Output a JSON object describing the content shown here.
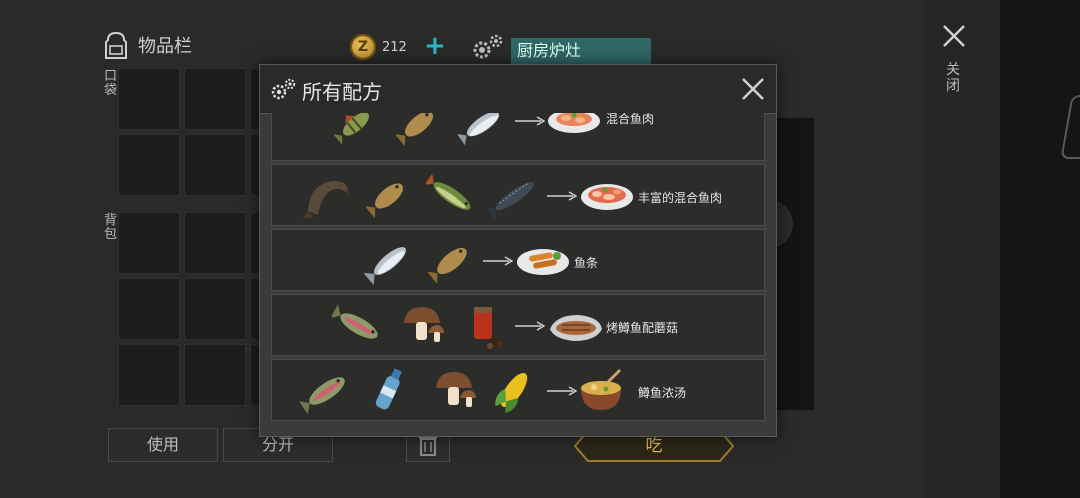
{
  "inventory": {
    "title": "物品栏",
    "pocket_label": "口袋",
    "backpack_label": "背包"
  },
  "currency": {
    "symbol": "Z",
    "amount": "212",
    "add_label": "+"
  },
  "crafting": {
    "station": "厨房炉灶"
  },
  "actions": {
    "use": "使用",
    "split": "分开",
    "eat": "吃"
  },
  "close_label": "关闭",
  "modal": {
    "title": "所有配方",
    "recipes": [
      {
        "ingredients": [
          "perch-icon",
          "carp-icon",
          "salmon-icon"
        ],
        "result_icon": "mixed-fish-plate-icon",
        "result": "混合鱼肉"
      },
      {
        "ingredients": [
          "catfish-icon",
          "carp-icon",
          "pike-icon",
          "sturgeon-icon"
        ],
        "result_icon": "rich-mixed-fish-plate-icon",
        "result": "丰富的混合鱼肉"
      },
      {
        "ingredients": [
          "salmon-icon",
          "carp-icon"
        ],
        "result_icon": "fish-sticks-icon",
        "result": "鱼条"
      },
      {
        "ingredients": [
          "trout-icon",
          "mushroom-icon",
          "spices-icon"
        ],
        "result_icon": "grilled-trout-mushroom-icon",
        "result": "烤鳟鱼配蘑菇"
      },
      {
        "ingredients": [
          "trout-icon",
          "water-bottle-icon",
          "mushroom-icon",
          "corn-icon"
        ],
        "result_icon": "trout-soup-icon",
        "result": "鳟鱼浓汤"
      }
    ]
  },
  "colors": {
    "accent_teal": "#2bb7c9",
    "eat_gold": "#e0b94b",
    "station_bg": "#2f6666"
  }
}
